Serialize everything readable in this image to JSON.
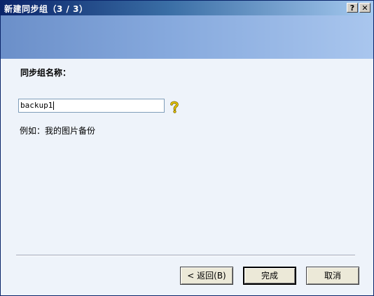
{
  "window": {
    "title": "新建同步组（3 / 3）",
    "help_glyph": "?",
    "close_glyph": "✕"
  },
  "form": {
    "group_label": "同步组名称：",
    "name_value": "backup1",
    "example_text": "例如：我的图片备份"
  },
  "buttons": {
    "back_label": "< 返回(B)",
    "finish_label": "完成",
    "cancel_label": "取消"
  },
  "colors": {
    "titlebar_start": "#0a246a",
    "banner": "#86a9dd",
    "body_bg": "#eef3fa",
    "help_icon": "#d4b000"
  },
  "icons": {
    "help": "question-mark-icon"
  }
}
